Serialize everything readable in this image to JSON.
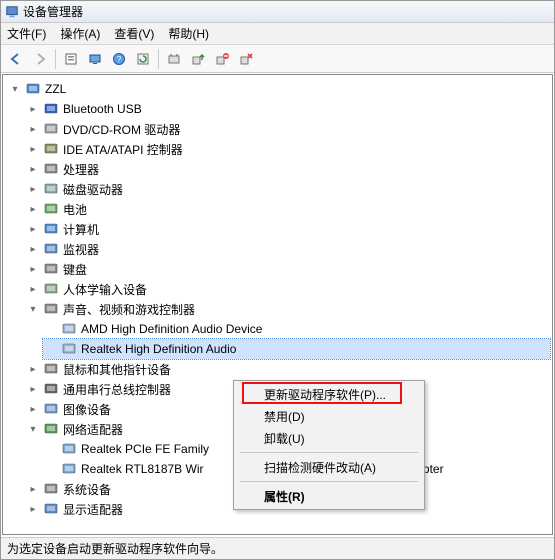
{
  "window": {
    "title": "设备管理器"
  },
  "menu": {
    "file": "文件(F)",
    "action": "操作(A)",
    "view": "查看(V)",
    "help": "帮助(H)"
  },
  "toolbar_icons": [
    "back-icon",
    "forward-icon",
    "up-icon",
    "properties-icon",
    "monitor-icon",
    "help-icon",
    "refresh-icon",
    "scan-icon",
    "add-legacy-icon",
    "remove-icon",
    "update-icon"
  ],
  "tree": {
    "root": {
      "label": "ZZL",
      "icon": "computer-icon"
    },
    "devices": [
      {
        "label": "Bluetooth USB",
        "icon": "bluetooth-icon",
        "expandable": true
      },
      {
        "label": "DVD/CD-ROM 驱动器",
        "icon": "optical-drive-icon",
        "expandable": true
      },
      {
        "label": "IDE ATA/ATAPI 控制器",
        "icon": "ide-icon",
        "expandable": true
      },
      {
        "label": "处理器",
        "icon": "cpu-icon",
        "expandable": true
      },
      {
        "label": "磁盘驱动器",
        "icon": "disk-icon",
        "expandable": true
      },
      {
        "label": "电池",
        "icon": "battery-icon",
        "expandable": true
      },
      {
        "label": "计算机",
        "icon": "computer-icon",
        "expandable": true
      },
      {
        "label": "监视器",
        "icon": "monitor-icon",
        "expandable": true
      },
      {
        "label": "键盘",
        "icon": "keyboard-icon",
        "expandable": true
      },
      {
        "label": "人体学输入设备",
        "icon": "hid-icon",
        "expandable": true
      },
      {
        "label": "声音、视频和游戏控制器",
        "icon": "sound-icon",
        "expandable": true,
        "expanded": true,
        "children": [
          {
            "label": "AMD High Definition Audio Device",
            "icon": "audio-device-icon"
          },
          {
            "label": "Realtek High Definition Audio",
            "icon": "audio-device-icon",
            "selected": true
          }
        ]
      },
      {
        "label": "鼠标和其他指针设备",
        "icon": "mouse-icon",
        "expandable": true
      },
      {
        "label": "通用串行总线控制器",
        "icon": "usb-icon",
        "expandable": true
      },
      {
        "label": "图像设备",
        "icon": "imaging-icon",
        "expandable": true
      },
      {
        "label": "网络适配器",
        "icon": "network-icon",
        "expandable": true,
        "expanded": true,
        "children": [
          {
            "label": "Realtek PCIe FE Family",
            "icon": "nic-icon",
            "truncated": true
          },
          {
            "label": "Realtek RTL8187B Wireless 802.11b/g 54Mbps USB 2.0 Network Adapter",
            "icon": "nic-icon",
            "truncated_mid": true
          }
        ]
      },
      {
        "label": "系统设备",
        "icon": "system-icon",
        "expandable": true
      },
      {
        "label": "显示适配器",
        "icon": "display-icon",
        "expandable": true
      }
    ]
  },
  "context_menu": {
    "items": [
      {
        "label": "更新驱动程序软件(P)...",
        "highlighted": true
      },
      {
        "label": "禁用(D)"
      },
      {
        "label": "卸载(U)"
      },
      {
        "sep": true
      },
      {
        "label": "扫描检测硬件改动(A)"
      },
      {
        "sep": true
      },
      {
        "label": "属性(R)",
        "bold": true
      }
    ]
  },
  "status": "为选定设备启动更新驱动程序软件向导。"
}
